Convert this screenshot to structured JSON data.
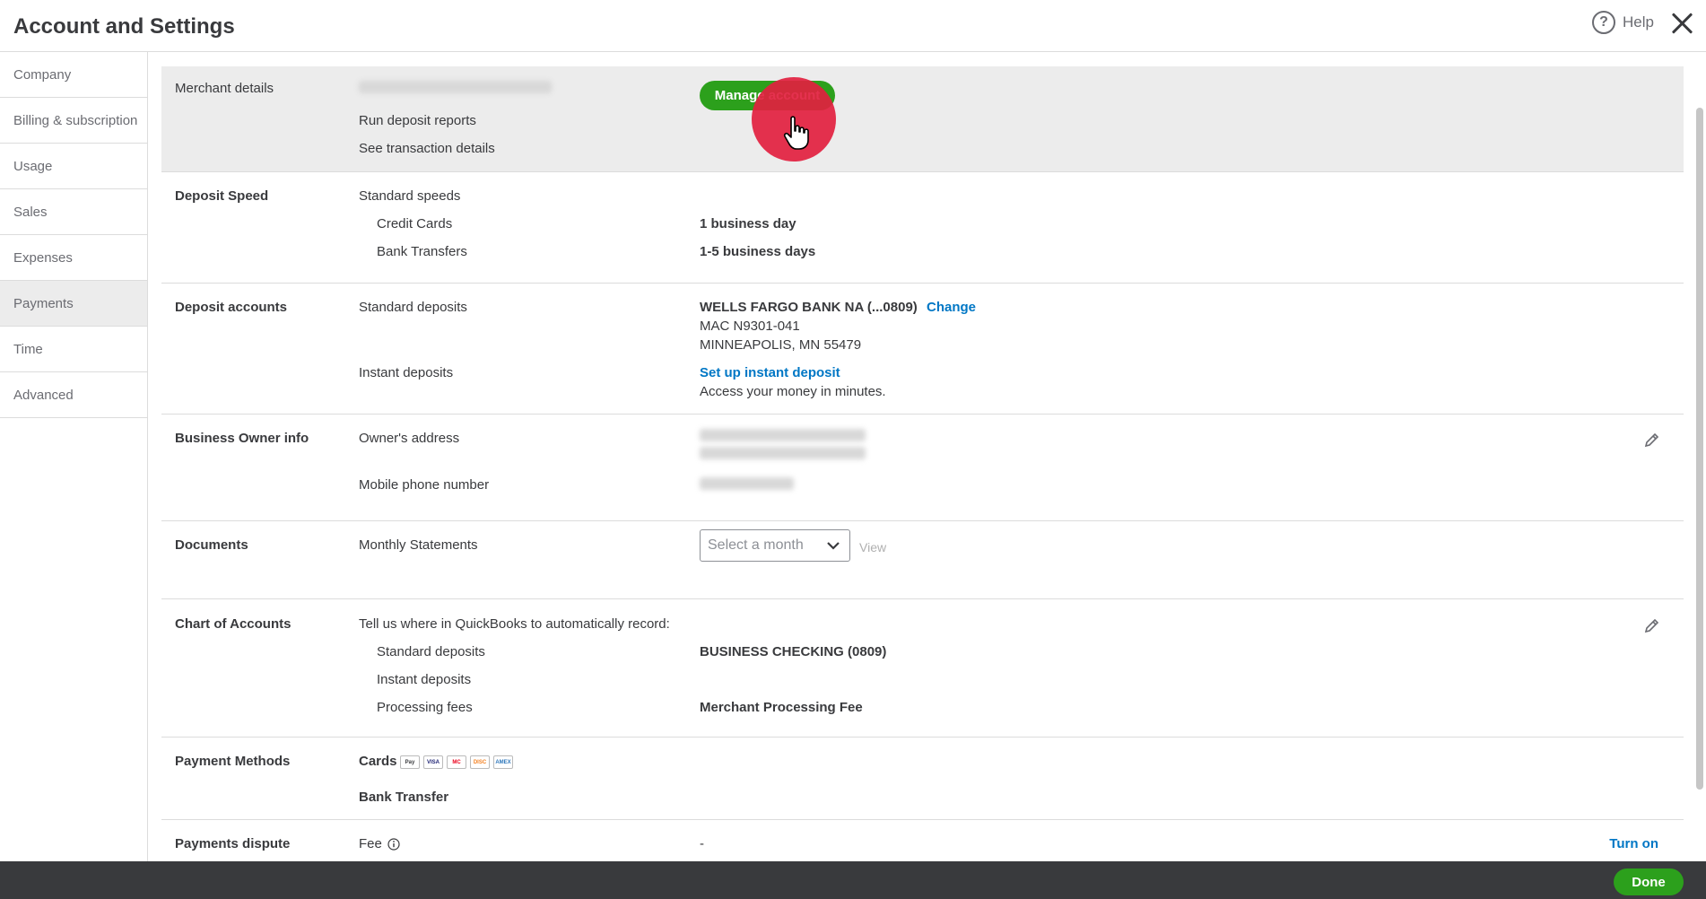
{
  "header": {
    "title": "Account and Settings",
    "help_label": "Help"
  },
  "sidebar": {
    "items": [
      {
        "label": "Company"
      },
      {
        "label": "Billing & subscription"
      },
      {
        "label": "Usage"
      },
      {
        "label": "Sales"
      },
      {
        "label": "Expenses"
      },
      {
        "label": "Payments"
      },
      {
        "label": "Time"
      },
      {
        "label": "Advanced"
      }
    ],
    "active": "Payments"
  },
  "merchant": {
    "label": "Merchant details",
    "run_reports": "Run deposit reports",
    "see_transactions": "See transaction details",
    "manage_button": "Manage account"
  },
  "deposit_speed": {
    "label": "Deposit Speed",
    "standard": "Standard speeds",
    "credit_cards": "Credit Cards",
    "credit_cards_value": "1 business day",
    "bank_transfers": "Bank Transfers",
    "bank_transfers_value": "1-5 business days"
  },
  "deposit_accounts": {
    "label": "Deposit accounts",
    "standard": "Standard deposits",
    "bank_name": "WELLS FARGO BANK NA (...0809)",
    "change_link": "Change",
    "bank_line2": "MAC N9301-041",
    "bank_line3": "MINNEAPOLIS, MN 55479",
    "instant": "Instant deposits",
    "setup_instant": "Set up instant deposit",
    "access_money": "Access your money in minutes."
  },
  "owner": {
    "label": "Business Owner info",
    "address": "Owner's address",
    "phone": "Mobile phone number"
  },
  "documents": {
    "label": "Documents",
    "monthly": "Monthly Statements",
    "select_placeholder": "Select a month",
    "view": "View"
  },
  "chart_of_accounts": {
    "label": "Chart of Accounts",
    "tell_us": "Tell us where in QuickBooks to automatically record:",
    "standard": "Standard deposits",
    "standard_value": "BUSINESS CHECKING (0809)",
    "instant": "Instant deposits",
    "fees": "Processing fees",
    "fees_value": "Merchant Processing Fee"
  },
  "payment_methods": {
    "label": "Payment Methods",
    "cards": "Cards",
    "card_icons": [
      "Pay",
      "VISA",
      "MC",
      "DISC",
      "AMEX"
    ],
    "bank_transfer": "Bank Transfer"
  },
  "dispute": {
    "label": "Payments dispute",
    "fee": "Fee",
    "fee_value": "-",
    "turn_on": "Turn on"
  },
  "footer": {
    "done": "Done"
  },
  "colors": {
    "accent_green": "#2ca01c",
    "link_blue": "#0077c5",
    "footer_bg": "#393a3d",
    "highlight_bg": "#ececec"
  }
}
